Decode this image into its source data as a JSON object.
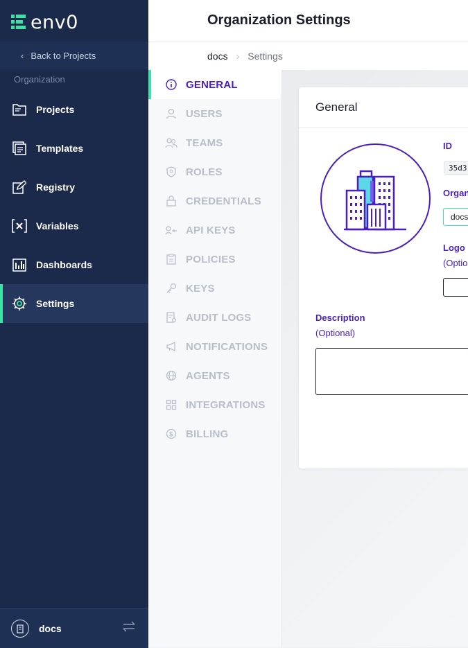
{
  "app": {
    "name": "env0",
    "back_label": "Back to Projects",
    "section_label": "Organization"
  },
  "sidebar": {
    "items": [
      {
        "label": "Projects",
        "icon": "folder-icon"
      },
      {
        "label": "Templates",
        "icon": "template-icon"
      },
      {
        "label": "Registry",
        "icon": "edit-icon"
      },
      {
        "label": "Variables",
        "icon": "variables-icon"
      },
      {
        "label": "Dashboards",
        "icon": "dashboard-icon"
      },
      {
        "label": "Settings",
        "icon": "gear-icon",
        "active": true
      }
    ],
    "footer": {
      "org_name": "docs"
    }
  },
  "header": {
    "title": "Organization Settings"
  },
  "breadcrumb": {
    "org": "docs",
    "page": "Settings"
  },
  "settings_nav": {
    "items": [
      {
        "label": "GENERAL",
        "icon": "info-icon",
        "active": true
      },
      {
        "label": "USERS",
        "icon": "user-icon"
      },
      {
        "label": "TEAMS",
        "icon": "team-icon"
      },
      {
        "label": "ROLES",
        "icon": "shield-icon"
      },
      {
        "label": "CREDENTIALS",
        "icon": "lock-icon"
      },
      {
        "label": "API KEYS",
        "icon": "api-key-icon"
      },
      {
        "label": "POLICIES",
        "icon": "clipboard-icon"
      },
      {
        "label": "KEYS",
        "icon": "key-icon"
      },
      {
        "label": "AUDIT LOGS",
        "icon": "audit-log-icon"
      },
      {
        "label": "NOTIFICATIONS",
        "icon": "megaphone-icon"
      },
      {
        "label": "AGENTS",
        "icon": "globe-icon"
      },
      {
        "label": "INTEGRATIONS",
        "icon": "grid-icon"
      },
      {
        "label": "BILLING",
        "icon": "dollar-icon"
      }
    ]
  },
  "general": {
    "title": "General",
    "id_label": "ID",
    "id_value": "35d3",
    "org_name_label": "Organ",
    "org_name_value": "docs",
    "logo_label": "Logo",
    "logo_optional": "(Optio",
    "description_label": "Description",
    "description_optional": "(Optional)"
  },
  "colors": {
    "sidebar_bg": "#1b2a4a",
    "accent_green": "#3ee1a6",
    "brand_purple": "#4a1fbd"
  }
}
